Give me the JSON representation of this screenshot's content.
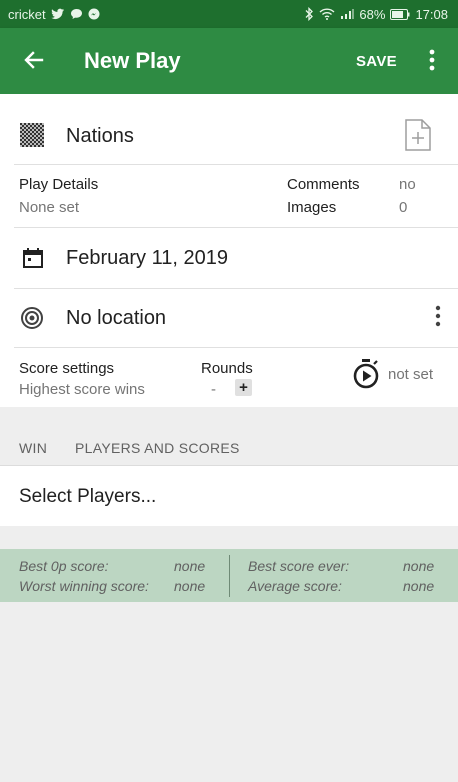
{
  "status_bar": {
    "carrier": "cricket",
    "battery": "68%",
    "time": "17:08"
  },
  "app_bar": {
    "title": "New Play",
    "save_label": "SAVE"
  },
  "game": {
    "name": "Nations"
  },
  "play_details": {
    "label": "Play Details",
    "value": "None set",
    "comments_label": "Comments",
    "comments_value": "no",
    "images_label": "Images",
    "images_value": "0"
  },
  "date": {
    "value": "February 11, 2019"
  },
  "location": {
    "value": "No location"
  },
  "score": {
    "settings_label": "Score settings",
    "settings_value": "Highest score wins",
    "rounds_label": "Rounds",
    "rounds_value": "-",
    "timer_value": "not set"
  },
  "players_section": {
    "win_label": "WIN",
    "players_label": "PLAYERS AND SCORES",
    "select_label": "Select Players..."
  },
  "stats": {
    "best_0p_label": "Best 0p score:",
    "best_0p_value": "none",
    "worst_winning_label": "Worst winning score:",
    "worst_winning_value": "none",
    "best_ever_label": "Best score ever:",
    "best_ever_value": "none",
    "average_label": "Average score:",
    "average_value": "none"
  },
  "colors": {
    "status_bar": "#1e6f2e",
    "app_bar": "#2e8b43",
    "stats_bg": "#bcd6c2"
  }
}
